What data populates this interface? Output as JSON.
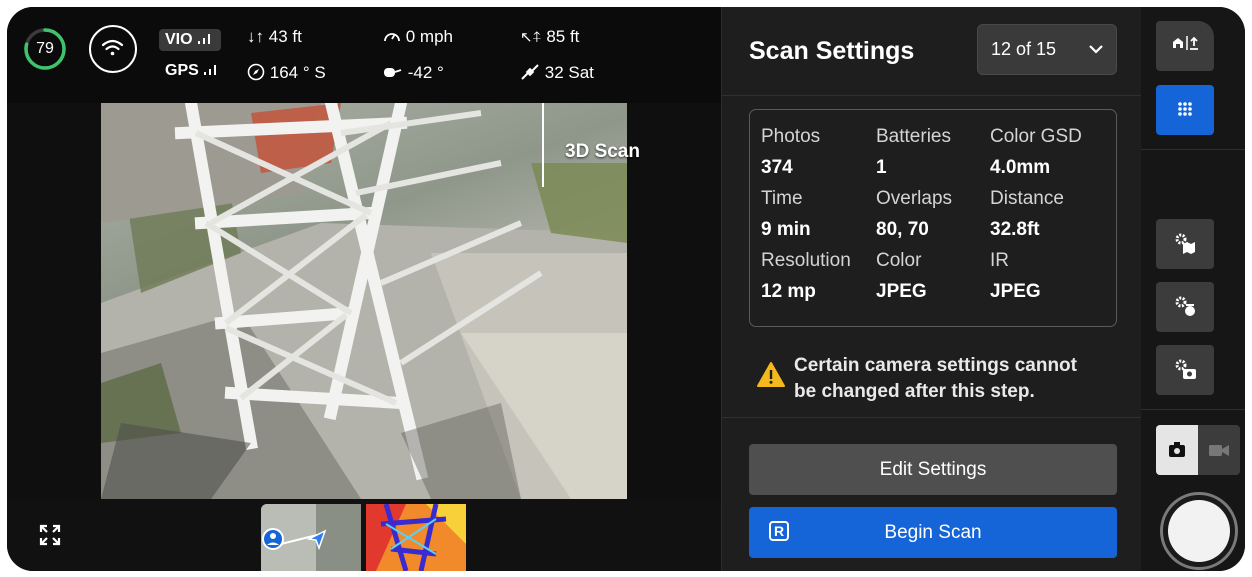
{
  "telemetry": {
    "battery_percent": "79",
    "battery_level_fraction": 0.79,
    "vio_label": "VIO",
    "gps_label": "GPS",
    "vertical_speed": "43 ft",
    "heading": "164 ° S",
    "speed": "0 mph",
    "gimbal_pitch": "-42 °",
    "altitude": "85 ft",
    "satellites": "32 Sat"
  },
  "video": {
    "mode_label": "3D Scan"
  },
  "panel": {
    "title": "Scan Settings",
    "step": "12 of 15",
    "stats": [
      {
        "label": "Photos",
        "value": "374"
      },
      {
        "label": "Batteries",
        "value": "1"
      },
      {
        "label": "Color GSD",
        "value": "4.0mm"
      },
      {
        "label": "Time",
        "value": "9 min"
      },
      {
        "label": "Overlaps",
        "value": "80, 70"
      },
      {
        "label": "Distance",
        "value": "32.8ft"
      },
      {
        "label": "Resolution",
        "value": "12 mp"
      },
      {
        "label": "Color",
        "value": "JPEG"
      },
      {
        "label": "IR",
        "value": "JPEG"
      }
    ],
    "warning_line1": "Certain camera settings cannot",
    "warning_line2": "be changed after this step.",
    "edit_button": "Edit Settings",
    "begin_button": "Begin Scan",
    "begin_key": "R"
  },
  "colors": {
    "accent_blue": "#1565d8",
    "battery_green": "#3ec46d",
    "warning_yellow": "#f5b81c"
  },
  "icons": {
    "home_return": "home-takeoff-icon",
    "grid": "grid-dots-icon",
    "map_settings": "gear-map-icon",
    "flight_settings": "gear-drone-icon",
    "camera_settings": "gear-camera-icon",
    "photo_mode": "camera-icon",
    "video_mode": "video-camera-icon",
    "fullscreen": "expand-icon",
    "warning": "warning-triangle-icon"
  }
}
